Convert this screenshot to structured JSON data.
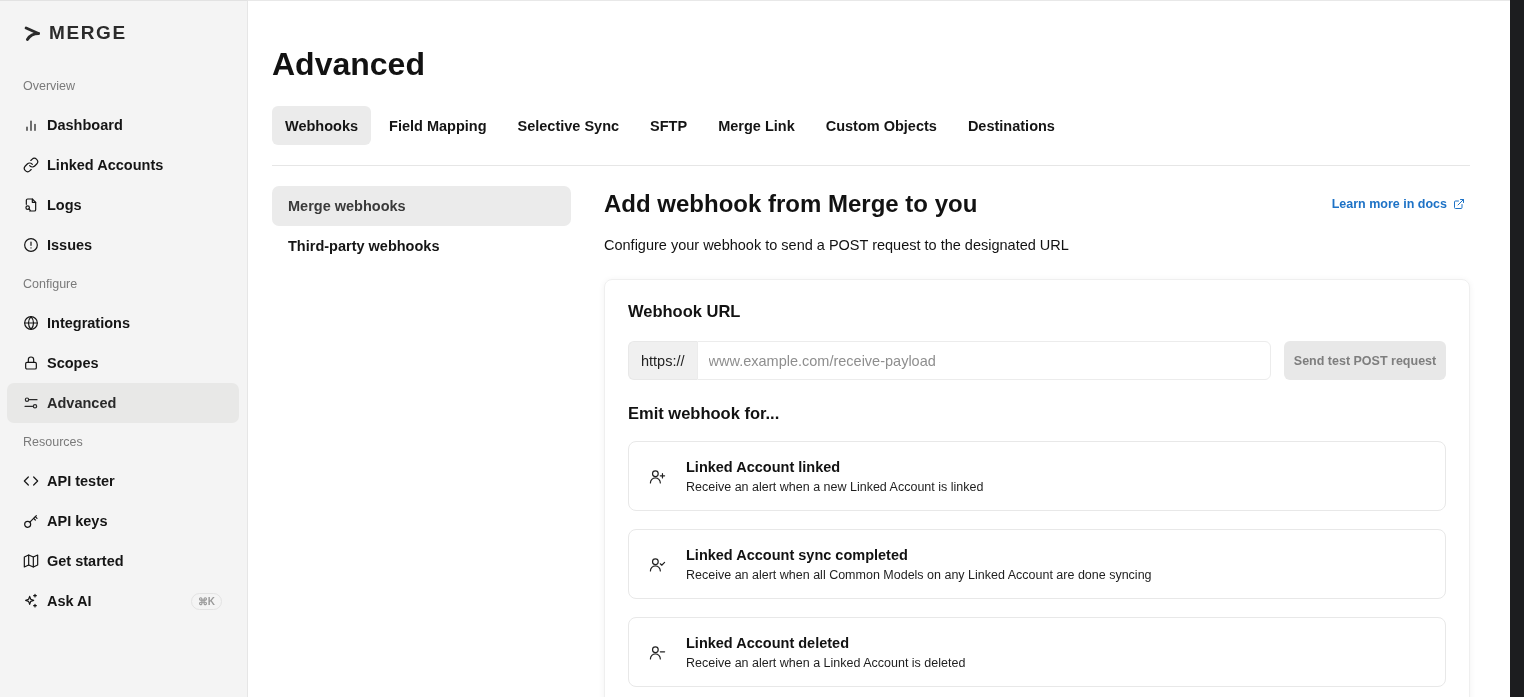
{
  "sidebar": {
    "logo": "MERGE",
    "sections": [
      {
        "heading": "Overview",
        "items": [
          {
            "label": "Dashboard",
            "selected": false
          },
          {
            "label": "Linked Accounts",
            "selected": false
          },
          {
            "label": "Logs",
            "selected": false
          },
          {
            "label": "Issues",
            "selected": false
          }
        ]
      },
      {
        "heading": "Configure",
        "items": [
          {
            "label": "Integrations",
            "selected": false
          },
          {
            "label": "Scopes",
            "selected": false
          },
          {
            "label": "Advanced",
            "selected": true
          }
        ]
      },
      {
        "heading": "Resources",
        "items": [
          {
            "label": "API tester",
            "selected": false
          },
          {
            "label": "API keys",
            "selected": false
          },
          {
            "label": "Get started",
            "selected": false
          },
          {
            "label": "Ask AI",
            "selected": false,
            "shortcut": "⌘K"
          }
        ]
      }
    ]
  },
  "page": {
    "title": "Advanced"
  },
  "tabs": [
    {
      "label": "Webhooks",
      "selected": true
    },
    {
      "label": "Field Mapping",
      "selected": false
    },
    {
      "label": "Selective Sync",
      "selected": false
    },
    {
      "label": "SFTP",
      "selected": false
    },
    {
      "label": "Merge Link",
      "selected": false
    },
    {
      "label": "Custom Objects",
      "selected": false
    },
    {
      "label": "Destinations",
      "selected": false
    }
  ],
  "subnav": [
    {
      "label": "Merge webhooks",
      "selected": true
    },
    {
      "label": "Third-party webhooks",
      "selected": false
    }
  ],
  "section": {
    "title": "Add webhook from Merge to you",
    "docs_link": "Learn more in docs",
    "description": "Configure your webhook to send a POST request to the designated URL"
  },
  "webhook_card": {
    "title": "Webhook URL",
    "url_prefix": "https://",
    "url_field": {
      "placeholder": "www.example.com/receive-payload"
    },
    "test_button": {
      "label": "Send test POST request",
      "disabled": true
    },
    "events_heading": "Emit webhook for...",
    "events": [
      {
        "title": "Linked Account linked",
        "description": "Receive an alert when a new Linked Account is linked"
      },
      {
        "title": "Linked Account sync completed",
        "description": "Receive an alert when all Common Models on any Linked Account are done syncing"
      },
      {
        "title": "Linked Account deleted",
        "description": "Receive an alert when a Linked Account is deleted"
      }
    ]
  }
}
